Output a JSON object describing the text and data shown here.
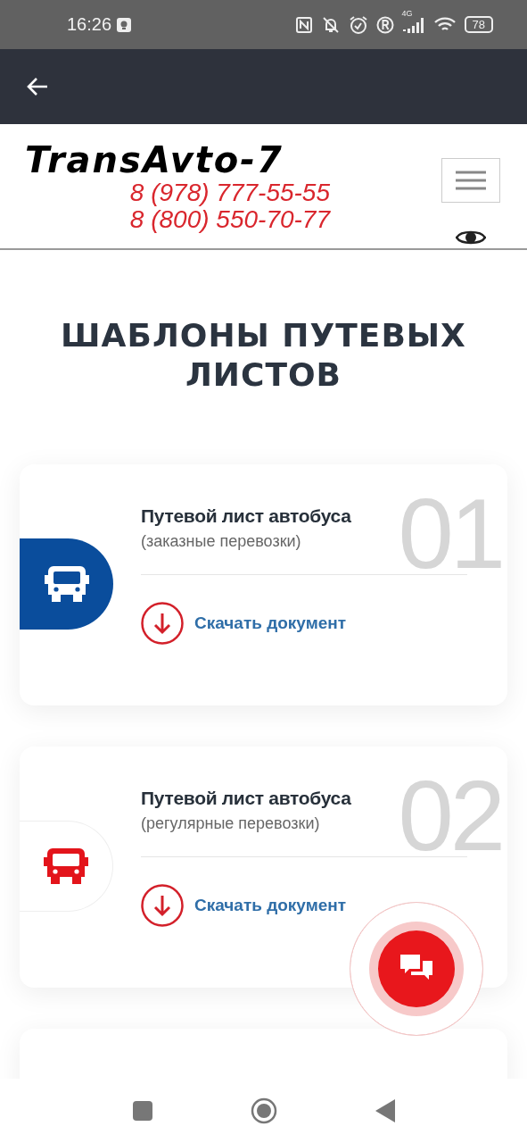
{
  "status_bar": {
    "time": "16:26",
    "network": "4G",
    "battery": "78"
  },
  "header": {
    "logo": "TransAvto-7",
    "phones": [
      "8 (978) 777-55-55",
      "8 (800) 550-70-77"
    ]
  },
  "page_title": "ШАБЛОНЫ ПУТЕВЫХ ЛИСТОВ",
  "cards": [
    {
      "number": "01",
      "title": "Путевой лист автобуса",
      "subtitle": "(заказные перевозки)",
      "link": "Скачать документ",
      "active": true
    },
    {
      "number": "02",
      "title": "Путевой лист автобуса",
      "subtitle": "(регулярные перевозки)",
      "link": "Скачать документ",
      "active": false
    }
  ],
  "partial_card": {
    "kind": "card"
  }
}
